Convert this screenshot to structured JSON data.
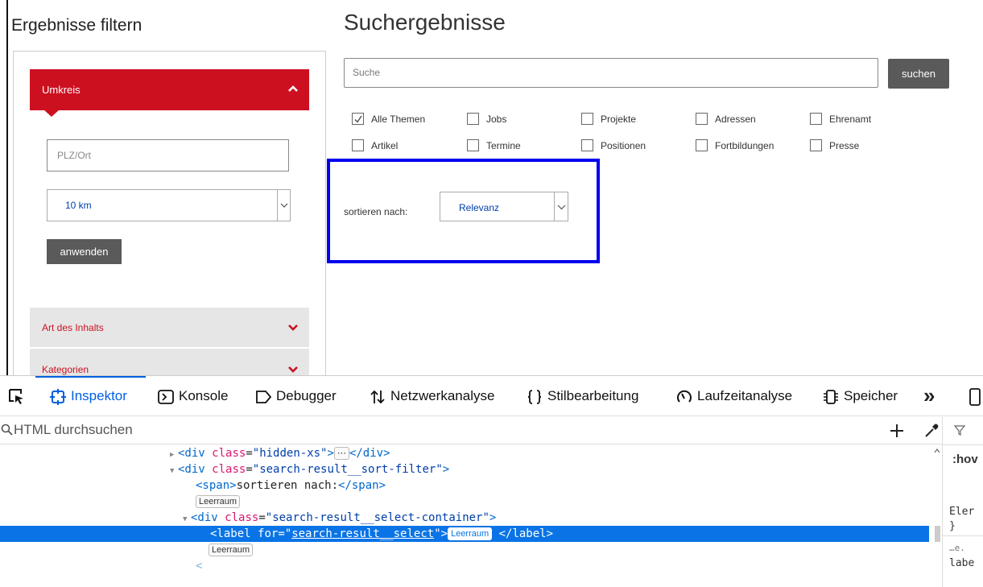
{
  "filters": {
    "title": "Ergebnisse filtern",
    "umkreis_label": "Umkreis",
    "plz_placeholder": "PLZ/Ort",
    "radius_value": "10 km",
    "apply_label": "anwenden",
    "content_type_label": "Art des Inhalts",
    "categories_label": "Kategorien"
  },
  "results": {
    "title": "Suchergebnisse",
    "search_placeholder": "Suche",
    "search_button": "suchen",
    "checkboxes": [
      {
        "label": "Alle Themen",
        "checked": true
      },
      {
        "label": "Jobs",
        "checked": false
      },
      {
        "label": "Projekte",
        "checked": false
      },
      {
        "label": "Adressen",
        "checked": false
      },
      {
        "label": "Ehrenamt",
        "checked": false
      },
      {
        "label": "Artikel",
        "checked": false
      },
      {
        "label": "Termine",
        "checked": false
      },
      {
        "label": "Positionen",
        "checked": false
      },
      {
        "label": "Fortbildungen",
        "checked": false
      },
      {
        "label": "Presse",
        "checked": false
      }
    ],
    "sort_label": "sortieren nach:",
    "sort_value": "Relevanz"
  },
  "devtools": {
    "tabs": {
      "inspector": "Inspektor",
      "console": "Konsole",
      "debugger": "Debugger",
      "network": "Netzwerkanalyse",
      "style": "Stilbearbeitung",
      "performance": "Laufzeitanalyse",
      "storage": "Speicher",
      "more": "»"
    },
    "search_placeholder": "HTML durchsuchen",
    "tree": {
      "l1_class": "hidden-xs",
      "l2_class": "search-result__sort-filter",
      "l3_text": "sortieren nach:",
      "whitespace": "Leerraum",
      "l5_class": "search-result__select-container",
      "l6_for": "search-result__select"
    },
    "right_panel": [
      ":hov",
      "Eler",
      "}",
      "…e.",
      "labe"
    ]
  },
  "colors": {
    "brand_red": "#cc1020",
    "highlight_blue": "#0000ee",
    "devtools_blue": "#0060df",
    "selection_blue": "#0a74e6"
  }
}
